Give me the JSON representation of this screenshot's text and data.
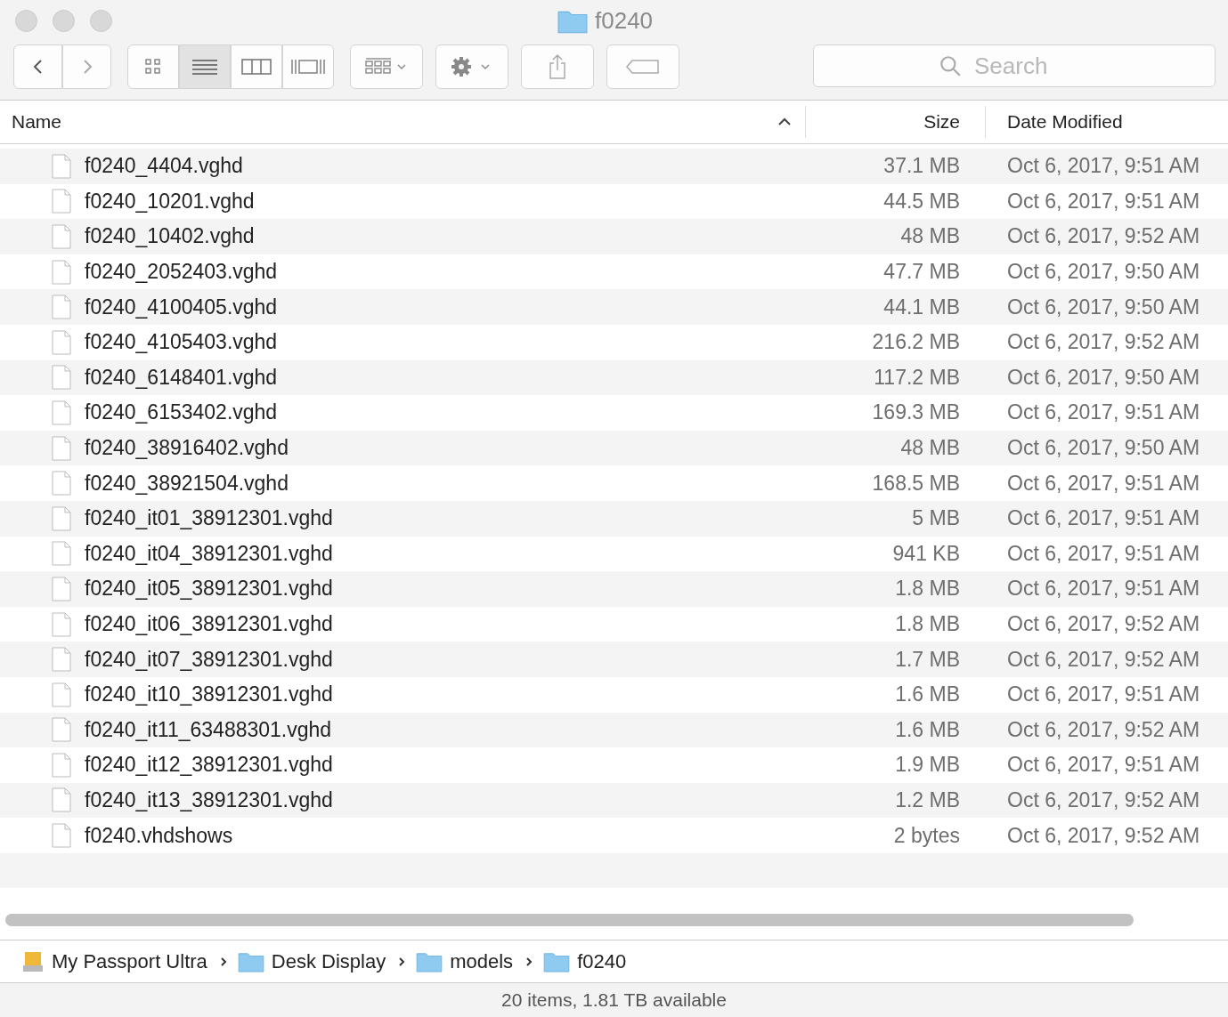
{
  "window": {
    "title": "f0240"
  },
  "toolbar": {
    "view_modes": [
      {
        "kind": "icons",
        "selected": false
      },
      {
        "kind": "list",
        "selected": true
      },
      {
        "kind": "columns",
        "selected": false
      },
      {
        "kind": "gallery",
        "selected": false
      }
    ],
    "search": {
      "placeholder": "Search"
    }
  },
  "table": {
    "columns": [
      {
        "label": "Name",
        "sorted": true
      },
      {
        "label": "Size",
        "sorted": false
      },
      {
        "label": "Date Modified",
        "sorted": false
      }
    ],
    "rows": [
      {
        "name": "f0240_4404.vghd",
        "size": "37.1 MB",
        "date": "Oct 6, 2017, 9:51 AM"
      },
      {
        "name": "f0240_10201.vghd",
        "size": "44.5 MB",
        "date": "Oct 6, 2017, 9:51 AM"
      },
      {
        "name": "f0240_10402.vghd",
        "size": "48 MB",
        "date": "Oct 6, 2017, 9:52 AM"
      },
      {
        "name": "f0240_2052403.vghd",
        "size": "47.7 MB",
        "date": "Oct 6, 2017, 9:50 AM"
      },
      {
        "name": "f0240_4100405.vghd",
        "size": "44.1 MB",
        "date": "Oct 6, 2017, 9:50 AM"
      },
      {
        "name": "f0240_4105403.vghd",
        "size": "216.2 MB",
        "date": "Oct 6, 2017, 9:52 AM"
      },
      {
        "name": "f0240_6148401.vghd",
        "size": "117.2 MB",
        "date": "Oct 6, 2017, 9:50 AM"
      },
      {
        "name": "f0240_6153402.vghd",
        "size": "169.3 MB",
        "date": "Oct 6, 2017, 9:51 AM"
      },
      {
        "name": "f0240_38916402.vghd",
        "size": "48 MB",
        "date": "Oct 6, 2017, 9:50 AM"
      },
      {
        "name": "f0240_38921504.vghd",
        "size": "168.5 MB",
        "date": "Oct 6, 2017, 9:51 AM"
      },
      {
        "name": "f0240_it01_38912301.vghd",
        "size": "5 MB",
        "date": "Oct 6, 2017, 9:51 AM"
      },
      {
        "name": "f0240_it04_38912301.vghd",
        "size": "941 KB",
        "date": "Oct 6, 2017, 9:51 AM"
      },
      {
        "name": "f0240_it05_38912301.vghd",
        "size": "1.8 MB",
        "date": "Oct 6, 2017, 9:51 AM"
      },
      {
        "name": "f0240_it06_38912301.vghd",
        "size": "1.8 MB",
        "date": "Oct 6, 2017, 9:52 AM"
      },
      {
        "name": "f0240_it07_38912301.vghd",
        "size": "1.7 MB",
        "date": "Oct 6, 2017, 9:52 AM"
      },
      {
        "name": "f0240_it10_38912301.vghd",
        "size": "1.6 MB",
        "date": "Oct 6, 2017, 9:51 AM"
      },
      {
        "name": "f0240_it11_63488301.vghd",
        "size": "1.6 MB",
        "date": "Oct 6, 2017, 9:52 AM"
      },
      {
        "name": "f0240_it12_38912301.vghd",
        "size": "1.9 MB",
        "date": "Oct 6, 2017, 9:51 AM"
      },
      {
        "name": "f0240_it13_38912301.vghd",
        "size": "1.2 MB",
        "date": "Oct 6, 2017, 9:52 AM"
      },
      {
        "name": "f0240.vhdshows",
        "size": "2 bytes",
        "date": "Oct 6, 2017, 9:52 AM"
      }
    ]
  },
  "path_bar": [
    {
      "kind": "drive",
      "label": "My Passport Ultra"
    },
    {
      "kind": "folder",
      "label": "Desk Display"
    },
    {
      "kind": "folder",
      "label": "models"
    },
    {
      "kind": "folder",
      "label": "f0240"
    }
  ],
  "status_bar": "20 items, 1.81 TB available"
}
